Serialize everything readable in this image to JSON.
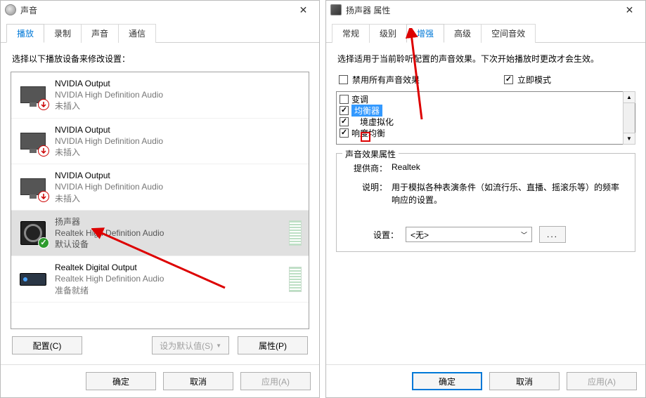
{
  "left": {
    "title": "声音",
    "tabs": [
      "播放",
      "录制",
      "声音",
      "通信"
    ],
    "selected_tab": 0,
    "instruction": "选择以下播放设备来修改设置：",
    "devices": [
      {
        "name": "NVIDIA Output",
        "sub": "NVIDIA High Definition Audio",
        "status": "未插入",
        "icon": "monitor",
        "badge": "down"
      },
      {
        "name": "NVIDIA Output",
        "sub": "NVIDIA High Definition Audio",
        "status": "未插入",
        "icon": "monitor",
        "badge": "down"
      },
      {
        "name": "NVIDIA Output",
        "sub": "NVIDIA High Definition Audio",
        "status": "未插入",
        "icon": "monitor",
        "badge": "down"
      },
      {
        "name": "扬声器",
        "sub": "Realtek High Definition Audio",
        "status": "默认设备",
        "icon": "speaker",
        "badge": "ok",
        "selected": true,
        "level": true
      },
      {
        "name": "Realtek Digital Output",
        "sub": "Realtek High Definition Audio",
        "status": "准备就绪",
        "icon": "digital",
        "level": true
      }
    ],
    "buttons": {
      "configure": "配置(C)",
      "set_default": "设为默认值(S)",
      "properties": "属性(P)"
    }
  },
  "right": {
    "title": "扬声器 属性",
    "tabs": [
      "常规",
      "级别",
      "增强",
      "高级",
      "空间音效"
    ],
    "selected_tab": 2,
    "instruction": "选择适用于当前聆听配置的声音效果。下次开始播放时更改才会生效。",
    "disable_all": {
      "label": "禁用所有声音效果",
      "checked": false
    },
    "instant": {
      "label": "立即模式",
      "checked": true
    },
    "effects": [
      {
        "label": "变调",
        "checked": false
      },
      {
        "label": "均衡器",
        "checked": true,
        "selected": true
      },
      {
        "label": "环境虚拟化",
        "checked": true,
        "annot": true
      },
      {
        "label": "响度均衡",
        "checked": true
      }
    ],
    "group_title": "声音效果属性",
    "props": {
      "provider_label": "提供商：",
      "provider": "Realtek",
      "descr_label": "说明：",
      "descr": "用于模拟各种表演条件（如流行乐、直播、摇滚乐等）的频率响应的设置。"
    },
    "settings": {
      "label": "设置：",
      "value": "<无>"
    }
  },
  "common_buttons": {
    "ok": "确定",
    "cancel": "取消",
    "apply": "应用(A)"
  }
}
